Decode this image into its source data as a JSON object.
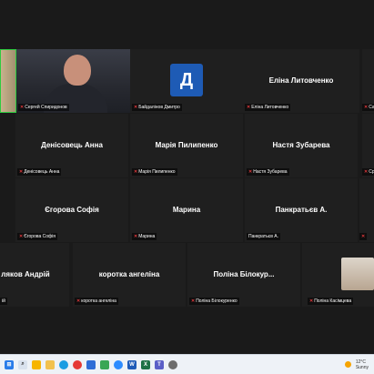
{
  "participants": [
    {
      "name": "Сергей Спиридонов",
      "label": "Сергей Спиридонов",
      "muted": true,
      "video": true
    },
    {
      "name": "Д",
      "label": "Байдалінов Дмитро",
      "muted": true,
      "avatar": true
    },
    {
      "name": "Еліна Литовченко",
      "label": "Еліна Литовченко",
      "muted": true
    },
    {
      "name": "Денісовець Анна",
      "label": "Денісовець Анна",
      "muted": true
    },
    {
      "name": "Марія Пилипенко",
      "label": "Марія Пилипенко",
      "muted": true
    },
    {
      "name": "Настя Зубарева",
      "label": "Настя Зубарева",
      "muted": true
    },
    {
      "name": "Єгорова Софія",
      "label": "Єгорова Софія",
      "muted": true
    },
    {
      "name": "Марина",
      "label": "Марина",
      "muted": true
    },
    {
      "name": "Панкратьєв А.",
      "label": "Панкратьєв А.",
      "muted": false
    },
    {
      "name": "ляков Андрій",
      "label": "ій",
      "muted": true
    },
    {
      "name": "коротка ангеліна",
      "label": "коротка ангеліна",
      "muted": true
    },
    {
      "name": "Поліна Білокур...",
      "label": "Поліна Білокуренко",
      "muted": true
    },
    {
      "name": "",
      "label": "Поліна Касімцева",
      "muted": true
    }
  ],
  "edge_labels": {
    "right_r1": "Са",
    "right_r2": "Ср"
  },
  "taskbar": {
    "icons": [
      "windows-icon",
      "search-icon",
      "task-view-icon",
      "explorer-icon",
      "edge-icon",
      "chrome-icon",
      "store-icon",
      "photos-icon",
      "zoom-icon",
      "word-icon",
      "excel-icon",
      "teams-icon",
      "settings-icon"
    ],
    "colors": {
      "windows-icon": "#2b7de9",
      "search-icon": "#d9e2ee",
      "task-view-icon": "#f7b500",
      "explorer-icon": "#f2c14e",
      "edge-icon": "#1b9de2",
      "chrome-icon": "#e53935",
      "store-icon": "#2f6dd6",
      "photos-icon": "#3aa655",
      "zoom-icon": "#2d8cff",
      "word-icon": "#1f5bb8",
      "excel-icon": "#1e7145",
      "teams-icon": "#5b5fc7",
      "settings-icon": "#6d6d6d"
    },
    "weather_temp": "12°C",
    "weather_desc": "Sunny"
  }
}
